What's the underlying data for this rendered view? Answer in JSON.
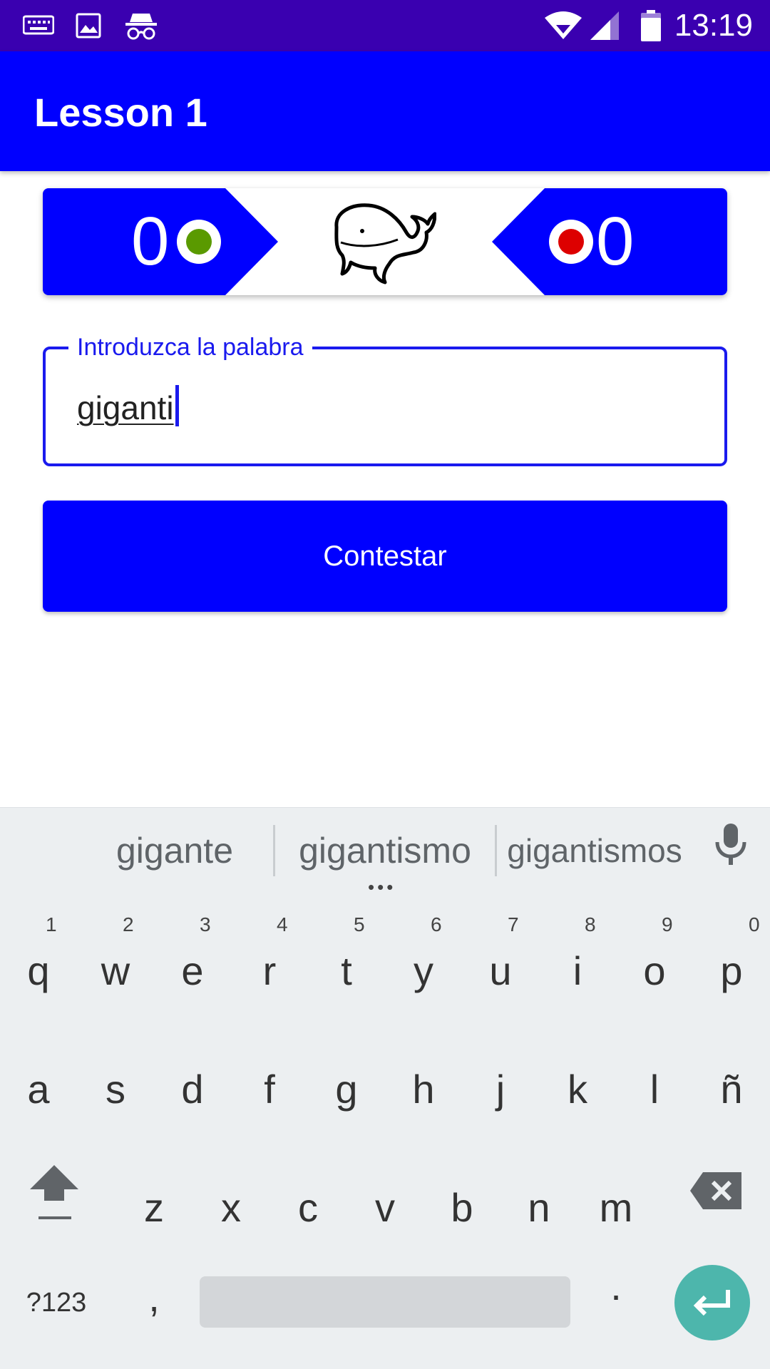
{
  "status_bar": {
    "time": "13:19",
    "icons": [
      "keyboard-icon",
      "image-icon",
      "incognito-icon",
      "wifi-icon",
      "signal-icon",
      "battery-icon"
    ]
  },
  "app_bar": {
    "title": "Lesson 1"
  },
  "score": {
    "correct": "0",
    "wrong": "0",
    "correct_color": "#5a9a00",
    "wrong_color": "#dd0000",
    "center_icon": "whale-icon"
  },
  "answer_field": {
    "label": "Introduzca la palabra",
    "value": "giganti"
  },
  "submit": {
    "label": "Contestar"
  },
  "keyboard": {
    "suggestions": [
      "gigante",
      "gigantismo",
      "gigantismos"
    ],
    "row1": [
      "q",
      "w",
      "e",
      "r",
      "t",
      "y",
      "u",
      "i",
      "o",
      "p"
    ],
    "row1_hints": [
      "1",
      "2",
      "3",
      "4",
      "5",
      "6",
      "7",
      "8",
      "9",
      "0"
    ],
    "row2": [
      "a",
      "s",
      "d",
      "f",
      "g",
      "h",
      "j",
      "k",
      "l",
      "ñ"
    ],
    "row3": [
      "z",
      "x",
      "c",
      "v",
      "b",
      "n",
      "m"
    ],
    "symbols_label": "?123",
    "comma": ",",
    "period": "."
  },
  "colors": {
    "status_bar": "#3a00b0",
    "primary": "#0000ff",
    "field_border": "#1a1aee",
    "enter_key": "#4db6ac"
  }
}
